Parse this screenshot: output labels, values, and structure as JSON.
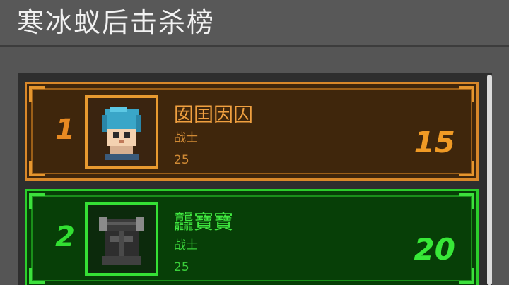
{
  "header": {
    "title": "寒冰蚁后击杀榜"
  },
  "leaderboard": {
    "entries": [
      {
        "rank": "1",
        "name": "囡囯因囚",
        "class": "战士",
        "level": "25",
        "kills": "15",
        "avatar_icon": "blue-hair-warrior-icon",
        "theme_color": "#d9882a"
      },
      {
        "rank": "2",
        "name": "龘寶寶",
        "class": "战士",
        "level": "25",
        "kills": "20",
        "avatar_icon": "horned-dark-helmet-icon",
        "theme_color": "#2bcf2b"
      }
    ]
  }
}
